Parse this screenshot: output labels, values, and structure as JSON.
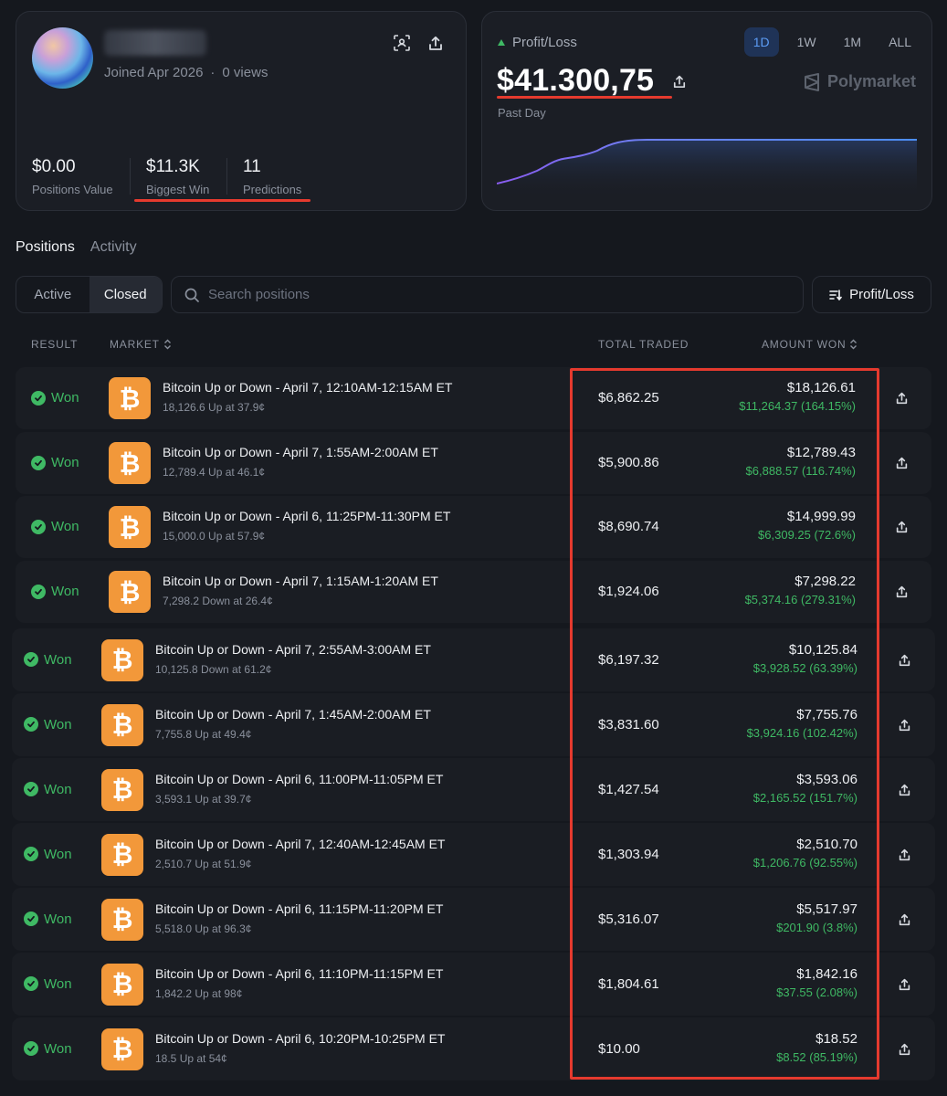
{
  "profile": {
    "joined": "Joined Apr 2026",
    "separator": "·",
    "views": "0 views",
    "stats": [
      {
        "value": "$0.00",
        "label": "Positions Value"
      },
      {
        "value": "$11.3K",
        "label": "Biggest Win"
      },
      {
        "value": "11",
        "label": "Predictions"
      }
    ]
  },
  "pnl": {
    "label": "Profit/Loss",
    "value": "$41.300,75",
    "period": "Past Day",
    "brand": "Polymarket",
    "ranges": [
      "1D",
      "1W",
      "1M",
      "ALL"
    ],
    "active_range": "1D"
  },
  "tabs": {
    "positions": "Positions",
    "activity": "Activity"
  },
  "filters": {
    "active": "Active",
    "closed": "Closed",
    "search_placeholder": "Search positions",
    "sort": "Profit/Loss"
  },
  "table": {
    "headers": {
      "result": "RESULT",
      "market": "MARKET",
      "total_traded": "TOTAL TRADED",
      "amount_won": "AMOUNT WON"
    },
    "rows": [
      {
        "result": "Won",
        "title": "Bitcoin Up or Down - April 7, 12:10AM-12:15AM ET",
        "sub": "18,126.6 Up at 37.9¢",
        "traded": "$6,862.25",
        "won": "$18,126.61",
        "pnl": "$11,264.37 (164.15%)"
      },
      {
        "result": "Won",
        "title": "Bitcoin Up or Down - April 7, 1:55AM-2:00AM ET",
        "sub": "12,789.4 Up at 46.1¢",
        "traded": "$5,900.86",
        "won": "$12,789.43",
        "pnl": "$6,888.57 (116.74%)"
      },
      {
        "result": "Won",
        "title": "Bitcoin Up or Down - April 6, 11:25PM-11:30PM ET",
        "sub": "15,000.0 Up at 57.9¢",
        "traded": "$8,690.74",
        "won": "$14,999.99",
        "pnl": "$6,309.25 (72.6%)"
      },
      {
        "result": "Won",
        "title": "Bitcoin Up or Down - April 7, 1:15AM-1:20AM ET",
        "sub": "7,298.2 Down at 26.4¢",
        "traded": "$1,924.06",
        "won": "$7,298.22",
        "pnl": "$5,374.16 (279.31%)"
      },
      {
        "result": "Won",
        "title": "Bitcoin Up or Down - April 7, 2:55AM-3:00AM ET",
        "sub": "10,125.8 Down at 61.2¢",
        "traded": "$6,197.32",
        "won": "$10,125.84",
        "pnl": "$3,928.52 (63.39%)"
      },
      {
        "result": "Won",
        "title": "Bitcoin Up or Down - April 7, 1:45AM-2:00AM ET",
        "sub": "7,755.8 Up at 49.4¢",
        "traded": "$3,831.60",
        "won": "$7,755.76",
        "pnl": "$3,924.16 (102.42%)"
      },
      {
        "result": "Won",
        "title": "Bitcoin Up or Down - April 6, 11:00PM-11:05PM ET",
        "sub": "3,593.1 Up at 39.7¢",
        "traded": "$1,427.54",
        "won": "$3,593.06",
        "pnl": "$2,165.52 (151.7%)"
      },
      {
        "result": "Won",
        "title": "Bitcoin Up or Down - April 7, 12:40AM-12:45AM ET",
        "sub": "2,510.7 Up at 51.9¢",
        "traded": "$1,303.94",
        "won": "$2,510.70",
        "pnl": "$1,206.76 (92.55%)"
      },
      {
        "result": "Won",
        "title": "Bitcoin Up or Down - April 6, 11:15PM-11:20PM ET",
        "sub": "5,518.0 Up at 96.3¢",
        "traded": "$5,316.07",
        "won": "$5,517.97",
        "pnl": "$201.90 (3.8%)"
      },
      {
        "result": "Won",
        "title": "Bitcoin Up or Down - April 6, 11:10PM-11:15PM ET",
        "sub": "1,842.2 Up at 98¢",
        "traded": "$1,804.61",
        "won": "$1,842.16",
        "pnl": "$37.55 (2.08%)"
      },
      {
        "result": "Won",
        "title": "Bitcoin Up or Down - April 6, 10:20PM-10:25PM ET",
        "sub": "18.5 Up at 54¢",
        "traded": "$10.00",
        "won": "$18.52",
        "pnl": "$8.52 (85.19%)"
      }
    ]
  },
  "icons": {
    "scan": "scan-icon",
    "share": "share-icon",
    "search": "search-icon",
    "sort": "sort-icon",
    "bitcoin": "bitcoin-icon",
    "check": "check-icon"
  },
  "colors": {
    "accent_blue": "#5c9cf5",
    "won_green": "#3fb964",
    "btc_orange": "#f2983a",
    "highlight_red": "#e53a2e"
  }
}
